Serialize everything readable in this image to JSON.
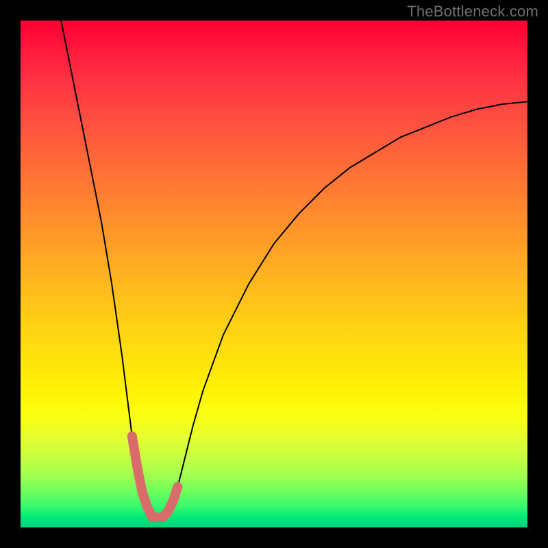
{
  "watermark": "TheBottleneck.com",
  "chart_data": {
    "type": "line",
    "title": "",
    "xlabel": "",
    "ylabel": "",
    "xlim": [
      0,
      100
    ],
    "ylim": [
      0,
      100
    ],
    "grid": false,
    "legend": false,
    "background_gradient": {
      "top": "#ff0033",
      "mid": "#ffd014",
      "bottom": "#00d47a"
    },
    "annotations": [
      {
        "kind": "valley-marker",
        "x_range": [
          22,
          31
        ],
        "y": 2,
        "color": "#d96b6b"
      }
    ],
    "series": [
      {
        "name": "bottleneck-curve",
        "color": "#000000",
        "x": [
          8,
          10,
          12,
          14,
          16,
          18,
          20,
          22,
          23,
          24,
          25,
          26,
          27,
          28,
          29,
          30,
          31,
          32,
          34,
          36,
          40,
          45,
          50,
          55,
          60,
          65,
          70,
          75,
          80,
          85,
          90,
          95,
          100
        ],
        "y": [
          100,
          90,
          80,
          70,
          60,
          48,
          34,
          18,
          12,
          7,
          4,
          2,
          2,
          2,
          3,
          5,
          8,
          12,
          20,
          27,
          38,
          48,
          56,
          62,
          67,
          71,
          74,
          77,
          79,
          81,
          82.5,
          83.5,
          84
        ]
      }
    ]
  }
}
